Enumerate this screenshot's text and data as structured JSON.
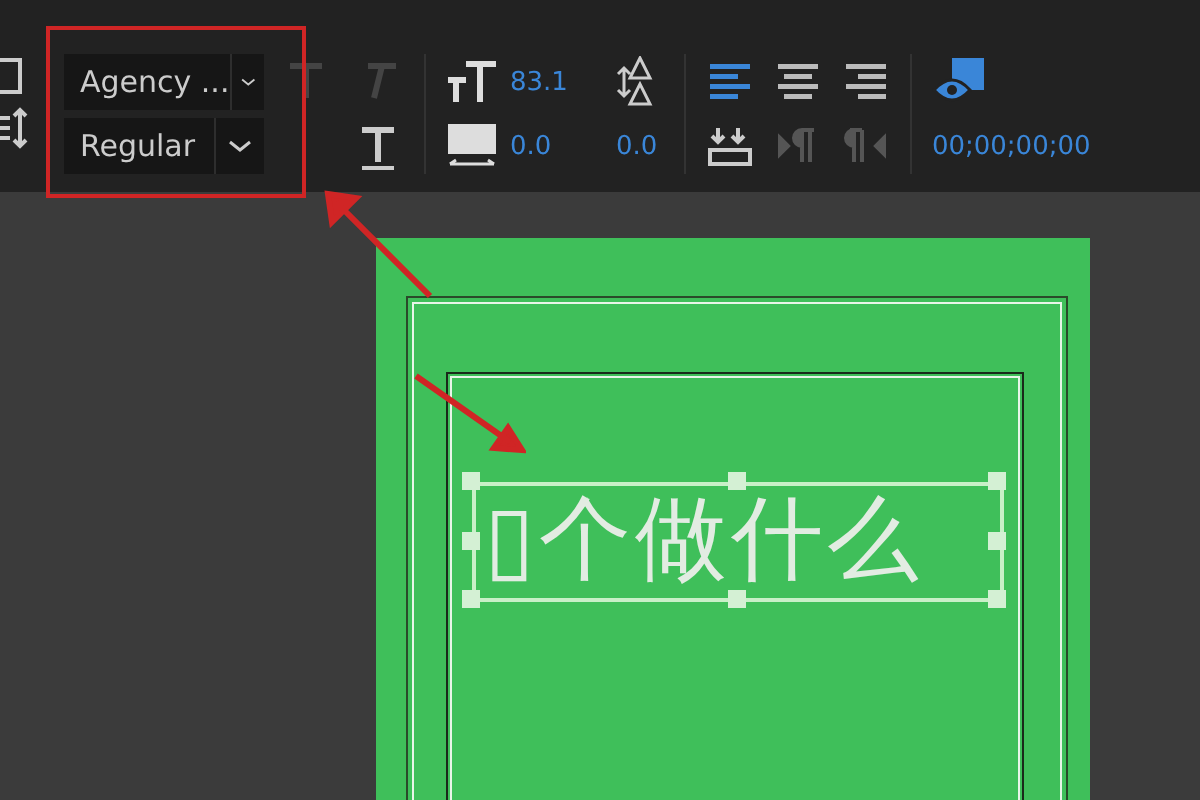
{
  "toolbar": {
    "font_family": {
      "value": "Agency ..."
    },
    "font_style": {
      "value": "Regular"
    },
    "style_buttons": [
      {
        "kind": "bold",
        "disabled": true
      },
      {
        "kind": "italic",
        "disabled": true
      },
      {
        "kind": "underline",
        "disabled": false
      }
    ],
    "font_size": "83.1",
    "kerning": "0.0",
    "leading": "0.0",
    "alignment": [
      {
        "kind": "left",
        "selected": true
      },
      {
        "kind": "center",
        "selected": false
      },
      {
        "kind": "right",
        "selected": false
      }
    ],
    "tab_buttons": [
      {
        "kind": "tab-stops",
        "disabled": false
      },
      {
        "kind": "ltr",
        "disabled": true
      },
      {
        "kind": "rtl",
        "disabled": true
      }
    ],
    "timecode": "00;00;00;00"
  },
  "canvas": {
    "text": "▯个做什么"
  }
}
